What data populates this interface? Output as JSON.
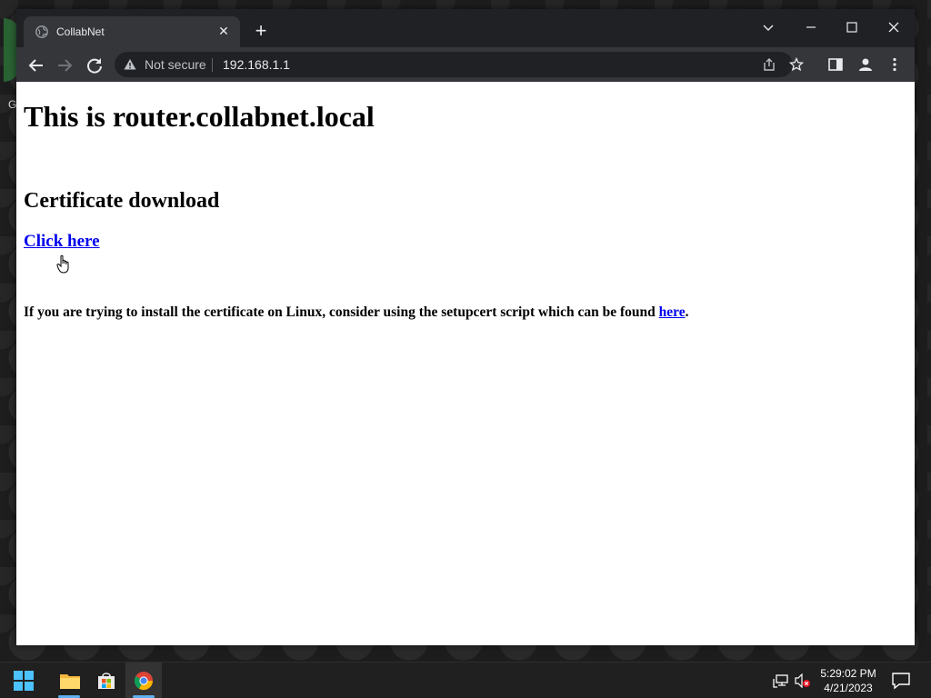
{
  "browser": {
    "tab": {
      "title": "CollabNet",
      "favicon": "globe-icon"
    },
    "address_bar": {
      "security_label": "Not secure",
      "url": "192.168.1.1"
    }
  },
  "page": {
    "heading": "This is router.collabnet.local",
    "subheading": "Certificate download",
    "download_link": "Click here",
    "linux_note_text": "If you are trying to install the certificate on Linux, consider using the setupcert script which can be found ",
    "linux_note_link": "here",
    "linux_note_end": "."
  },
  "desktop": {
    "icon_label": "G"
  },
  "taskbar": {
    "time": "5:29:02 PM",
    "date": "4/21/2023",
    "apps": [
      "start-icon",
      "file-explorer-icon",
      "store-icon",
      "chrome-icon"
    ]
  },
  "colors": {
    "link": "#0000ee",
    "tabstrip": "#202124",
    "toolbar": "#35363a",
    "taskbar": "#202020",
    "accent": "#60b0f0"
  }
}
